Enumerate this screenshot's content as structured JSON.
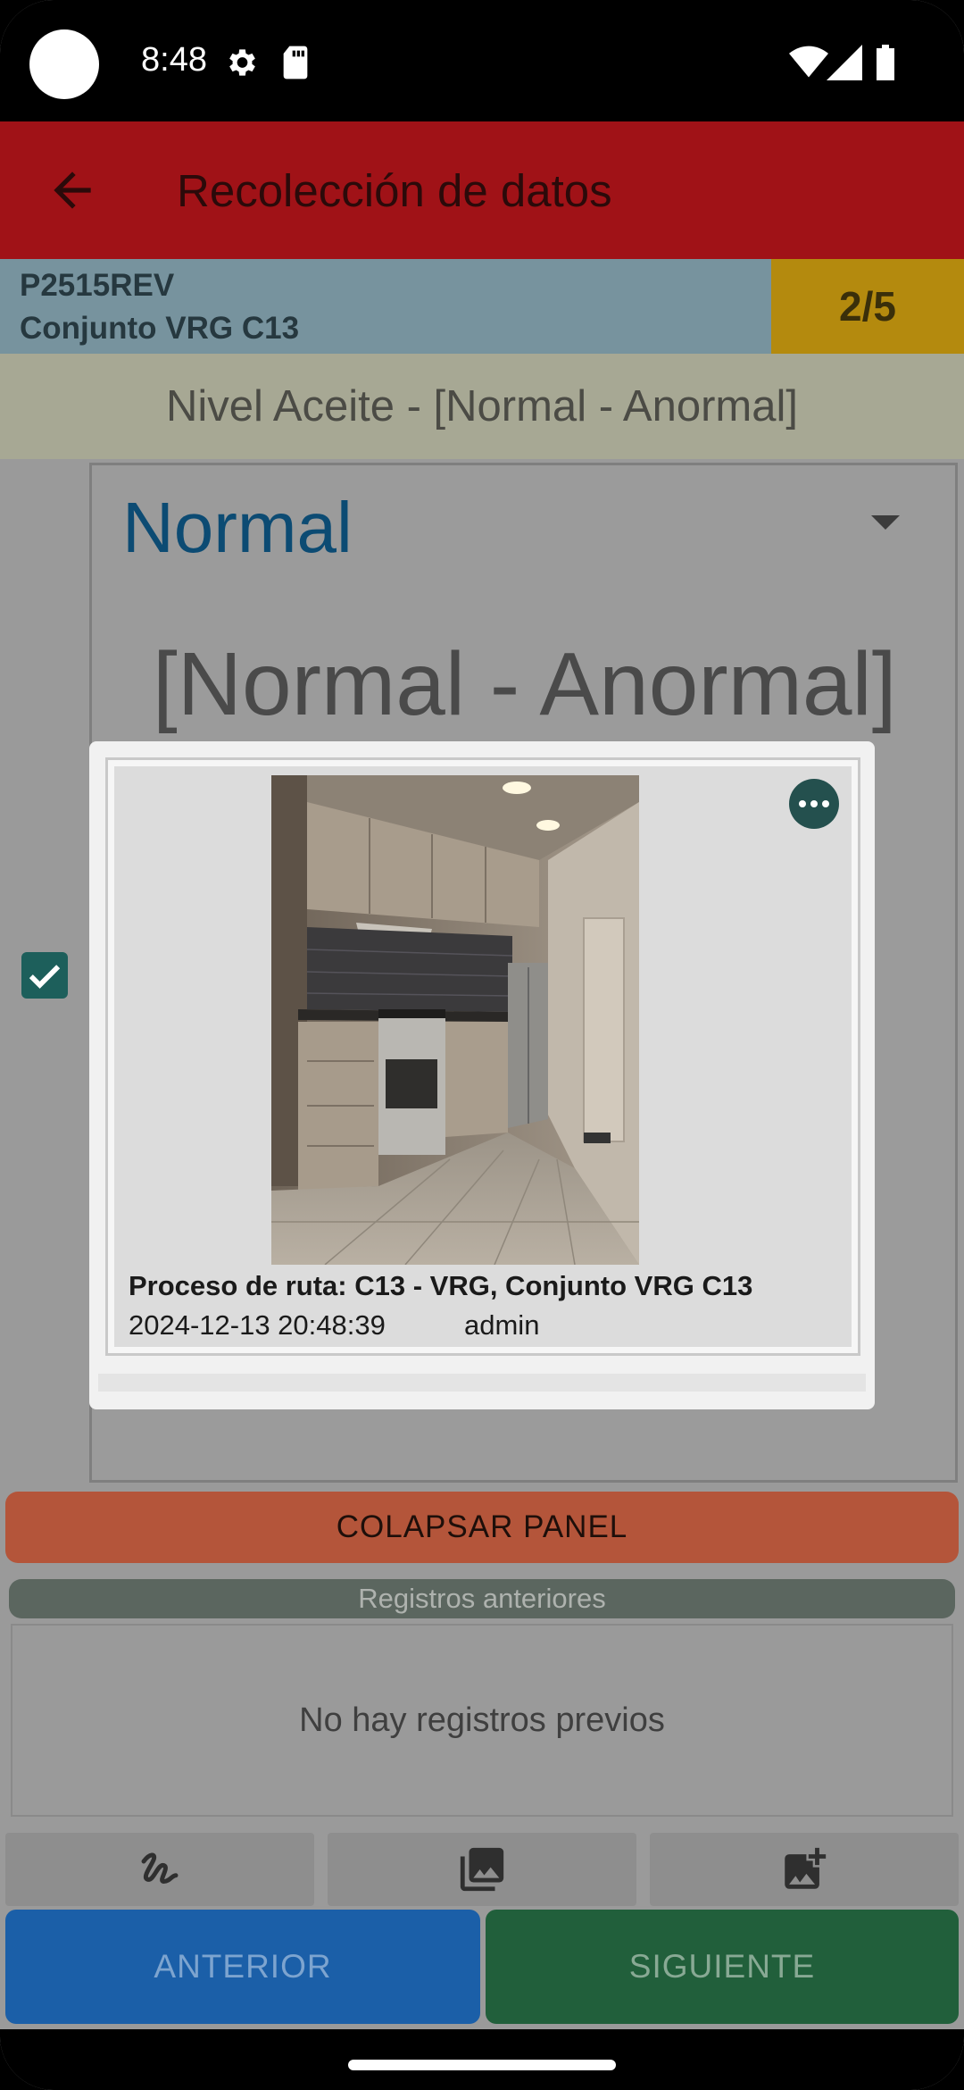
{
  "status_bar": {
    "time": "8:48",
    "icons_left": [
      "settings-icon",
      "sd-card-icon"
    ],
    "icons_right": [
      "wifi-icon",
      "signal-icon",
      "battery-icon"
    ]
  },
  "app_bar": {
    "title": "Recolección de datos",
    "back_icon": "arrow-back-icon",
    "color": "#a01217"
  },
  "header": {
    "code": "P2515REV",
    "set_name": "Conjunto VRG C13",
    "progress": "2/5"
  },
  "question": {
    "label": "Nivel Aceite - [Normal - Anormal]"
  },
  "form": {
    "selected_value": "Normal",
    "range_label": "[Normal - Anormal]",
    "checkbox_checked": true
  },
  "photo_dialog": {
    "caption": "Proceso de ruta: C13 - VRG, Conjunto VRG C13",
    "date": "2024-12-13 20:48:39",
    "user": "admin",
    "more_icon": "more-horiz-icon"
  },
  "actions": {
    "collapse_label": "COLAPSAR PANEL",
    "previous_records_title": "Registros anteriores",
    "no_previous": "No hay registros previos",
    "tools": [
      "signature-icon",
      "gallery-icon",
      "add-photo-icon"
    ],
    "prev_label": "ANTERIOR",
    "next_label": "SIGUIENTE"
  },
  "colors": {
    "prev_button": "#1b5fa8",
    "next_button": "#215f3b",
    "collapse_button": "#b4553a",
    "progress_badge": "#b48a0e"
  }
}
